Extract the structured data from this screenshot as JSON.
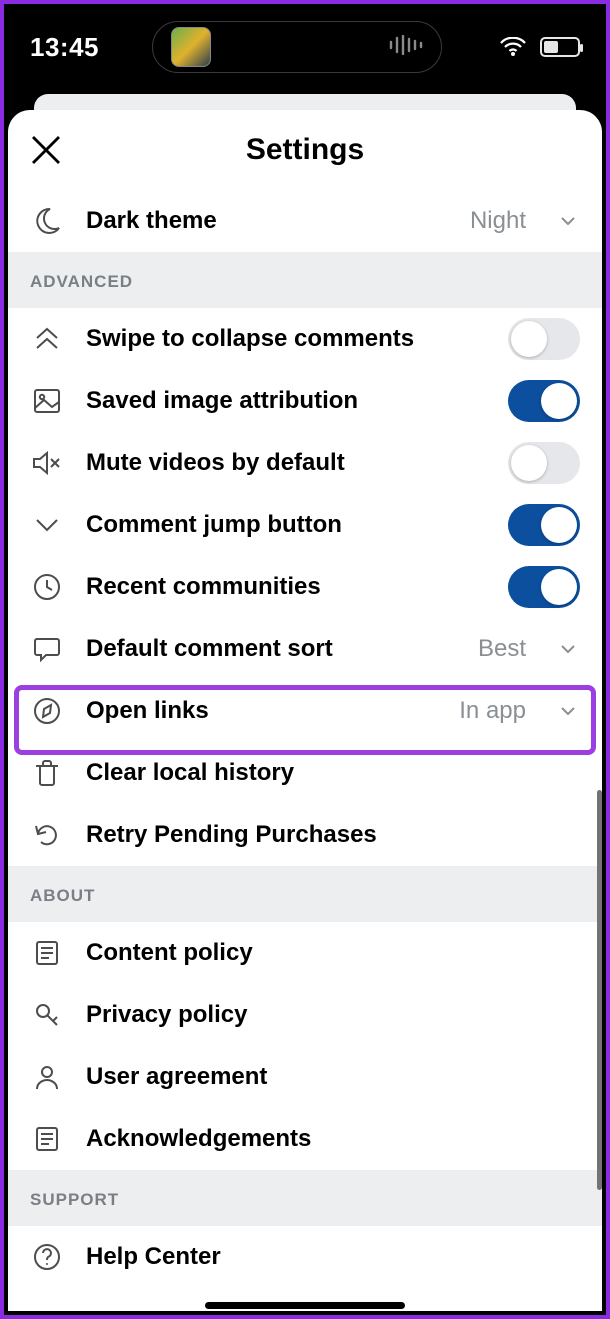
{
  "statusbar": {
    "time": "13:45"
  },
  "header": {
    "title": "Settings"
  },
  "dark_theme_row": {
    "label": "Dark theme",
    "value": "Night"
  },
  "sections": {
    "advanced": {
      "header": "ADVANCED",
      "rows": {
        "swipe": {
          "label": "Swipe to collapse comments"
        },
        "saved": {
          "label": "Saved image attribution"
        },
        "mute": {
          "label": "Mute videos by default"
        },
        "jump": {
          "label": "Comment jump button"
        },
        "recent": {
          "label": "Recent communities"
        },
        "sort": {
          "label": "Default comment sort",
          "value": "Best"
        },
        "links": {
          "label": "Open links",
          "value": "In app"
        },
        "clear": {
          "label": "Clear local history"
        },
        "retry": {
          "label": "Retry Pending Purchases"
        }
      }
    },
    "about": {
      "header": "ABOUT",
      "rows": {
        "content": {
          "label": "Content policy"
        },
        "privacy": {
          "label": "Privacy policy"
        },
        "user": {
          "label": "User agreement"
        },
        "ack": {
          "label": "Acknowledgements"
        }
      }
    },
    "support": {
      "header": "SUPPORT",
      "rows": {
        "help": {
          "label": "Help Center"
        }
      }
    }
  },
  "toggles": {
    "swipe": false,
    "saved": true,
    "mute": false,
    "jump": true,
    "recent": true
  }
}
